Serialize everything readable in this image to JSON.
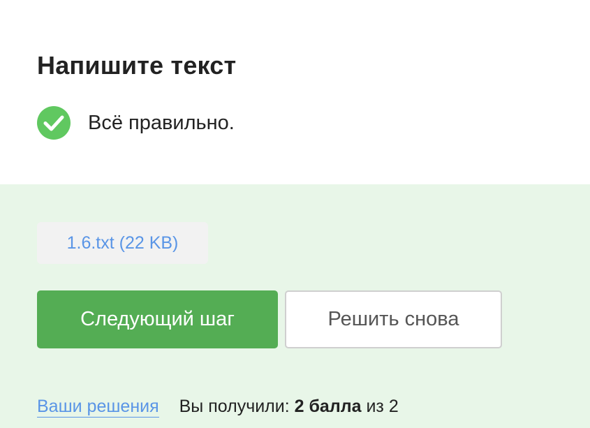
{
  "task": {
    "title": "Напишите текст",
    "status_text": "Всё правильно.",
    "status_icon": "check-circle-icon",
    "status_color": "#60c860"
  },
  "attachment": {
    "label": "1.6.txt (22 KB)"
  },
  "actions": {
    "next_label": "Следующий шаг",
    "retry_label": "Решить снова"
  },
  "footer": {
    "solutions_link": "Ваши решения",
    "score_prefix": "Вы получили:",
    "score_points": "2 балла",
    "score_suffix": "из 2"
  },
  "colors": {
    "accent_green": "#54ad54",
    "panel_background": "#e8f6e8",
    "link_blue": "#5a95e6"
  }
}
